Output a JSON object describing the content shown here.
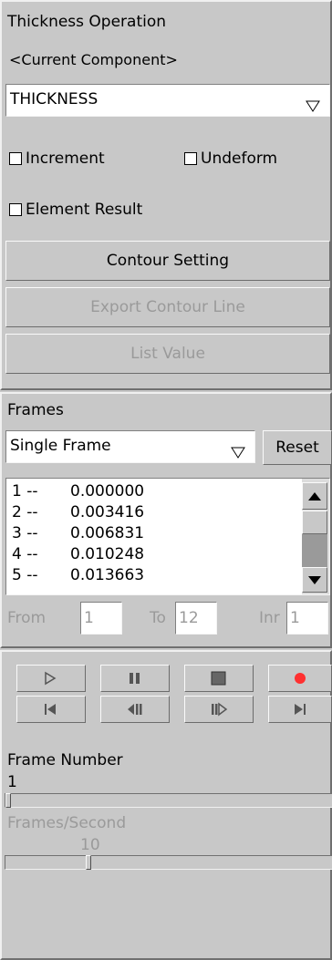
{
  "thickness": {
    "title": "Thickness Operation",
    "component_label": "<Current Component>",
    "component_select": "THICKNESS",
    "increment": {
      "label": "Increment",
      "checked": false
    },
    "undeform": {
      "label": "Undeform",
      "checked": false
    },
    "element_result": {
      "label": "Element Result",
      "checked": false
    },
    "contour_setting": "Contour Setting",
    "export_contour_line": "Export Contour Line",
    "list_value": "List Value"
  },
  "frames": {
    "title": "Frames",
    "mode": "Single Frame",
    "reset": "Reset",
    "list": [
      {
        "index": "1 --",
        "value": "0.000000"
      },
      {
        "index": "2 --",
        "value": "0.003416"
      },
      {
        "index": "3 --",
        "value": "0.006831"
      },
      {
        "index": "4 --",
        "value": "0.010248"
      },
      {
        "index": "5 --",
        "value": "0.013663"
      }
    ],
    "from_label": "From",
    "from_value": "1",
    "to_label": "To",
    "to_value": "12",
    "inr_label": "Inr",
    "inr_value": "1"
  },
  "playback": {
    "buttons": [
      "play-icon",
      "pause-icon",
      "stop-icon",
      "record-icon",
      "first-frame-icon",
      "step-back-icon",
      "step-forward-icon",
      "last-frame-icon"
    ],
    "record_color": "#ff3030",
    "frame_number_label": "Frame Number",
    "frame_number_value": "1",
    "frames_per_second_label": "Frames/Second",
    "frames_per_second_value": "10"
  },
  "colors": {
    "panel_bg": "#c8c8c8",
    "disabled_text": "#9a9a9a"
  }
}
